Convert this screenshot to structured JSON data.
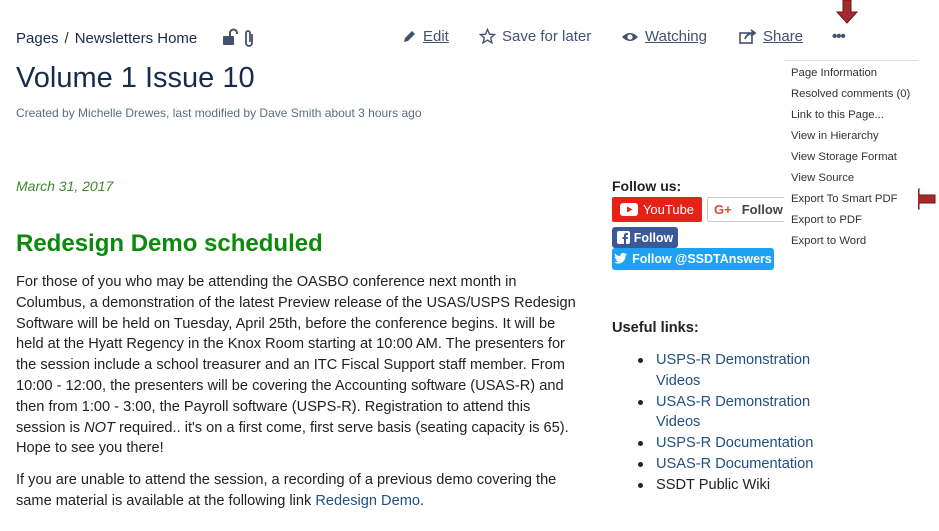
{
  "breadcrumb": {
    "pages": "Pages",
    "separator": "/",
    "parent": "Newsletters Home"
  },
  "toolbar": {
    "edit": "Edit",
    "save_for_later": "Save for later",
    "watching": "Watching",
    "share": "Share",
    "more": "•••"
  },
  "page": {
    "title": "Volume 1 Issue 10",
    "byline": "Created by Michelle Drewes, last modified by Dave Smith about 3 hours ago",
    "date": "March 31, 2017",
    "heading": "Redesign Demo scheduled",
    "para1_a": "For those of you who may be attending the OASBO conference next month in Columbus, a demonstration of the latest Preview release of the USAS/USPS Redesign Software will be held on Tuesday, April 25th, before the conference begins.  It will be held at the Hyatt Regency in the Knox Room starting at 10:00 AM.  The presenters for the session include a school treasurer and an ITC Fiscal Support staff member.  From 10:00 - 12:00, the presenters will be covering the Accounting software (USAS-R) and then from 1:00 - 3:00, the Payroll software (USPS-R). Registration to attend this session is ",
    "para1_em": "NOT",
    "para1_b": " required.. it's on a first come, first serve basis (seating capacity is 65).  Hope to see you there!",
    "para2_a": "If you are unable to attend the session, a recording of a previous demo covering the same material is available at the following link ",
    "para2_link": "Redesign Demo",
    "para2_b": "."
  },
  "social": {
    "heading": "Follow us:",
    "youtube": "YouTube",
    "gplus_icon": "G+",
    "gplus": "Follow",
    "facebook": "Follow",
    "twitter": "Follow @SSDTAnswers"
  },
  "useful_links": {
    "heading": "Useful links:",
    "items": [
      "USPS-R Demonstration Videos",
      "USAS-R Demonstration Videos",
      "USPS-R Documentation",
      "USAS-R Documentation",
      "SSDT Public Wiki"
    ]
  },
  "more_menu": {
    "items": [
      "Page Information",
      "Resolved comments (0)",
      "Link to this Page...",
      "View in Hierarchy",
      "View Storage Format",
      "View Source",
      "Export To Smart PDF",
      "Export to PDF",
      "Export to Word"
    ]
  },
  "icons": {
    "lock": "unlock-icon",
    "attach": "paperclip-icon",
    "edit": "pencil-icon",
    "star": "star-icon",
    "eye": "eye-icon",
    "share": "share-icon"
  },
  "colors": {
    "heading_green": "#0c8a0c",
    "date_green": "#3b8a2c",
    "link": "#205081",
    "youtube": "#e62117",
    "facebook": "#3b5998",
    "twitter": "#1da1f2",
    "annotation_arrow": "#a52a2a"
  }
}
